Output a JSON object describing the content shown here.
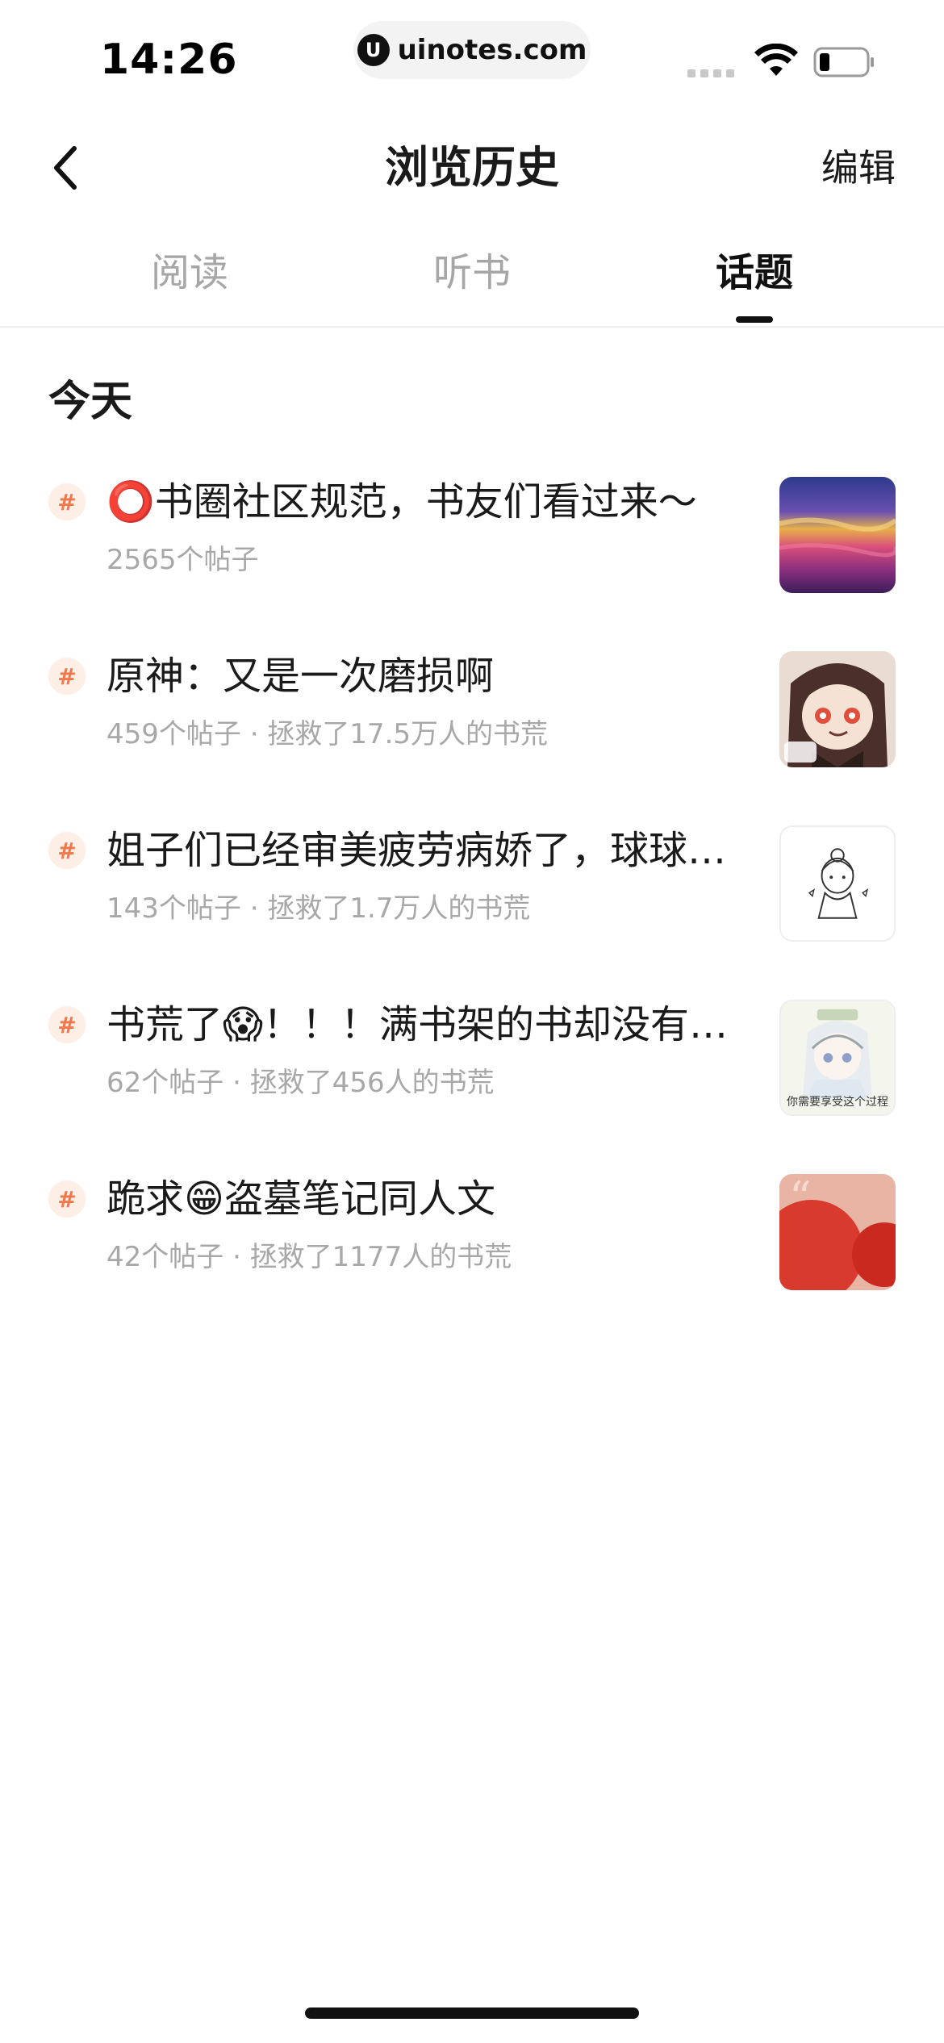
{
  "status_bar": {
    "time": "14:26",
    "url": "uinotes.com",
    "url_logo": "U"
  },
  "nav": {
    "title": "浏览历史",
    "edit_label": "编辑",
    "back_icon": "chevron-left-icon"
  },
  "tabs": [
    {
      "label": "阅读",
      "active": false
    },
    {
      "label": "听书",
      "active": false
    },
    {
      "label": "话题",
      "active": true
    }
  ],
  "section": {
    "heading": "今天"
  },
  "topics": [
    {
      "badge": "#",
      "title": "⭕书圈社区规范，书友们看过来～",
      "meta": "2565个帖子",
      "thumb": "sunset-gradient-image"
    },
    {
      "badge": "#",
      "title": "原神：又是一次磨损啊",
      "meta": "459个帖子 · 拯救了17.5万人的书荒",
      "thumb": "anime-girl-image"
    },
    {
      "badge": "#",
      "title": "姐子们已经审美疲劳病娇了，球球…",
      "meta": "143个帖子 · 拯救了1.7万人的书荒",
      "thumb": "sketch-girl-image"
    },
    {
      "badge": "#",
      "title": "书荒了😱！！！满书架的书却没有…",
      "meta": "62个帖子 · 拯救了456人的书荒",
      "thumb": "anime-meme-image",
      "thumb_caption": "你需要享受这个过程"
    },
    {
      "badge": "#",
      "title": "跪求😁盗墓笔记同人文",
      "meta": "42个帖子 · 拯救了1177人的书荒",
      "thumb": "red-quote-image"
    }
  ],
  "colors": {
    "accent": "#f0784a",
    "badge_bg": "#fdeee6",
    "meta_text": "#a8a8a8",
    "inactive_tab": "#a6a6a6"
  }
}
